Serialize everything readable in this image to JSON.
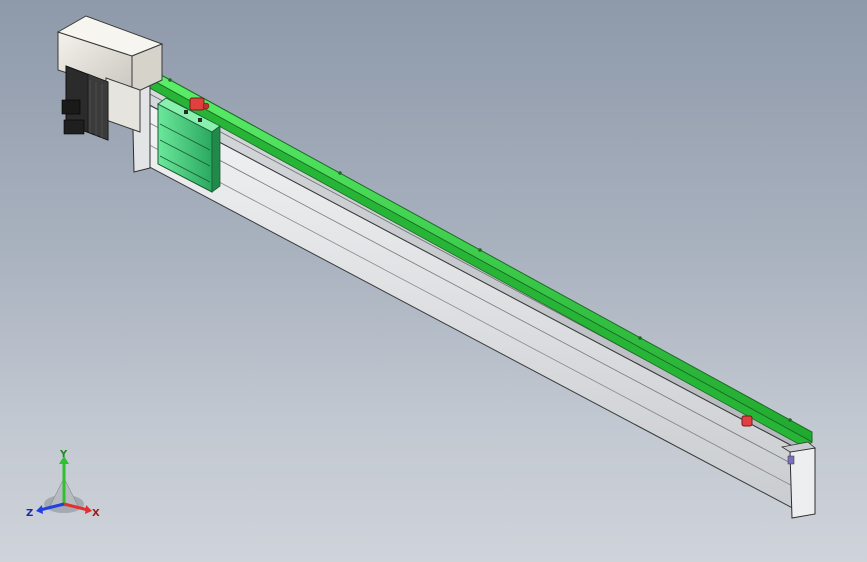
{
  "triad": {
    "y_label": "Y",
    "z_label": "Z",
    "x_label": "X"
  },
  "colors": {
    "background_top": "#8e99aa",
    "background_bottom": "#cfd3da",
    "beam": "#e4e6e8",
    "rail": "#39d64a",
    "motor_box": "#e8e6e0",
    "motor_body": "#2a2a2a",
    "carriage": "#3ecf7a",
    "stopper": "#e04040",
    "axis_x": "#e03030",
    "axis_y": "#30c030",
    "axis_z": "#2040e0"
  }
}
